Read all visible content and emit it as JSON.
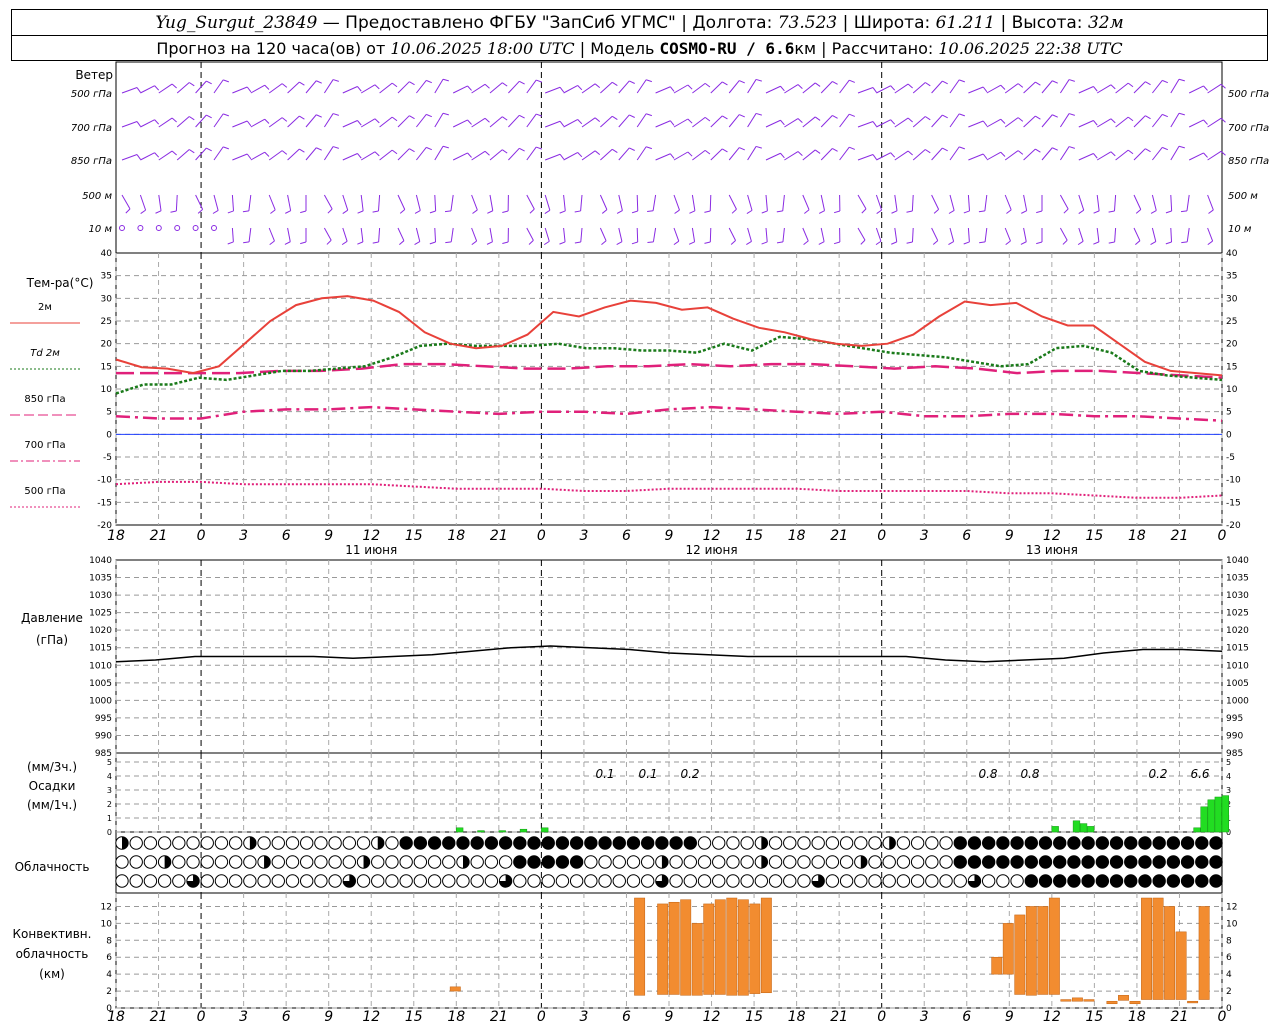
{
  "header": {
    "station": "Yug_Surgut_23849",
    "provider": " — Предоставлено ФГБУ \"ЗапСиб УГМС\" | Долгота: ",
    "lon": "73.523",
    "lat_label": " | Широта: ",
    "lat": "61.211",
    "alt_label": " | Высота: ",
    "alt": "32м",
    "forecast": "Прогноз на 120 часа(ов) от ",
    "start": "10.06.2025 18:00 UTC",
    "model_label": " | Модель ",
    "model": "COSMO-RU / 6.6",
    "model_unit": "км",
    "calc_label": " | Рассчитано: ",
    "calc": "10.06.2025 22:38 UTC"
  },
  "time_axis": {
    "hours": [
      "18",
      "21",
      "0",
      "3",
      "6",
      "9",
      "12",
      "15",
      "18",
      "21",
      "0",
      "3",
      "6",
      "9",
      "12",
      "15",
      "18",
      "21",
      "0",
      "3",
      "6",
      "9",
      "12",
      "15",
      "18",
      "21",
      "0"
    ],
    "days": [
      "11 июня",
      "12 июня",
      "13 июня"
    ]
  },
  "wind_panel": {
    "title": "Ветер",
    "levels": [
      "500 гПа",
      "700 гПа",
      "850 гПа",
      "500 м",
      "10  м"
    ],
    "barb_color": "#8a2be2"
  },
  "temp_panel": {
    "title": "Тем-ра(°C)",
    "legend": [
      {
        "label": "2м",
        "color": "#e8413a",
        "style": "solid"
      },
      {
        "label": "Td  2м",
        "color": "#1a7a1a",
        "style": "dotted"
      },
      {
        "label": "850 гПа",
        "color": "#e0207a",
        "style": "longdash"
      },
      {
        "label": "700 гПа",
        "color": "#e0207a",
        "style": "dashdot"
      },
      {
        "label": "500 гПа",
        "color": "#e0207a",
        "style": "dotted"
      }
    ],
    "yticks": [
      "40",
      "35",
      "30",
      "25",
      "20",
      "15",
      "10",
      "5",
      "0",
      "-5",
      "-10",
      "-15",
      "-20"
    ]
  },
  "pressure_panel": {
    "title": "Давление",
    "unit": "(гПа)",
    "yticks": [
      "1040",
      "1035",
      "1030",
      "1025",
      "1020",
      "1015",
      "1010",
      "1005",
      "1000",
      "995",
      "990",
      "985"
    ]
  },
  "precip_panel": {
    "unit3": "(мм/3ч.)",
    "title": "Осадки",
    "unit1": "(мм/1ч.)",
    "yticks": [
      "5",
      "4",
      "3",
      "2",
      "1",
      "0"
    ],
    "labels": [
      "0.1",
      "0.1",
      "0.2",
      "0.8",
      "0.8",
      "0.2",
      "6.6"
    ]
  },
  "cloud_panel": {
    "title": "Облачность"
  },
  "conv_panel": {
    "title1": "Конвективн.",
    "title2": "облачность",
    "unit": "(км)",
    "yticks": [
      "12",
      "10",
      "8",
      "6",
      "4",
      "2",
      "0"
    ]
  },
  "chart_data": {
    "type": "line",
    "x_hours_from_start": [
      0,
      3,
      6,
      9,
      12,
      15,
      18,
      21,
      24,
      27,
      30,
      33,
      36,
      39,
      42,
      45,
      48,
      51,
      54,
      57,
      60,
      63,
      66,
      69,
      72,
      75,
      78
    ],
    "t2m": [
      16.5,
      14.8,
      14.5,
      13.5,
      15,
      20,
      25,
      28.5,
      30,
      30.5,
      29.5,
      27,
      22.5,
      20,
      19,
      19.5,
      22,
      27,
      26,
      28,
      29.5,
      29,
      27.5,
      28,
      25.5,
      23.5,
      22.5,
      21,
      20,
      19.5,
      20,
      22,
      26,
      29.3,
      28.5,
      29,
      26,
      24,
      24,
      20,
      16,
      14,
      13.5,
      13
    ],
    "td2m": [
      9,
      11,
      11,
      12.5,
      12,
      13,
      14,
      14,
      14.5,
      15,
      17,
      19.5,
      20,
      19.5,
      19.5,
      19.5,
      20,
      19,
      19,
      18.5,
      18.5,
      18,
      20,
      18.5,
      21.5,
      21,
      20,
      19,
      18,
      17.5,
      17,
      16,
      15,
      15.5,
      19,
      19.5,
      18,
      14,
      13,
      12.5,
      12
    ],
    "t850": [
      13.5,
      13.5,
      13.5,
      13.5,
      14,
      14,
      14.5,
      15.5,
      15.5,
      15,
      14.5,
      14.5,
      15,
      15,
      15.5,
      15,
      15.5,
      15.5,
      15,
      14.5,
      15,
      14.5,
      13.5,
      14,
      14,
      13.5,
      13,
      12.5
    ],
    "t700": [
      4,
      3.5,
      3.5,
      5,
      5.5,
      5.5,
      6,
      5.5,
      5,
      4.5,
      5,
      5,
      4.5,
      5.5,
      6,
      5.5,
      5,
      4.5,
      5,
      4,
      4,
      4.5,
      4.5,
      4,
      4,
      3.5,
      3
    ],
    "t500": [
      -11,
      -10.5,
      -10.5,
      -11,
      -11,
      -11,
      -11,
      -11.5,
      -12,
      -12,
      -12,
      -12.5,
      -12.5,
      -12,
      -12,
      -12,
      -12,
      -12.5,
      -12.5,
      -12.5,
      -12.5,
      -13,
      -13,
      -13.5,
      -14,
      -14,
      -13.5
    ],
    "pressure": [
      1011,
      1011.5,
      1012.5,
      1012.5,
      1012.5,
      1012.5,
      1012,
      1012.5,
      1013,
      1014,
      1015,
      1015.5,
      1015,
      1014.5,
      1013.5,
      1013,
      1012.5,
      1012.5,
      1012.5,
      1012.5,
      1012.5,
      1011.5,
      1011,
      1011.5,
      1012,
      1013.5,
      1014.5,
      1014.5,
      1014
    ],
    "precip_1h": [
      {
        "h": 48,
        "v": 0.3
      },
      {
        "h": 51,
        "v": 0.1
      },
      {
        "h": 54,
        "v": 0.1
      },
      {
        "h": 57,
        "v": 0.2
      },
      {
        "h": 60,
        "v": 0.3
      },
      {
        "h": 132,
        "v": 0.4
      },
      {
        "h": 135,
        "v": 0.8
      },
      {
        "h": 136,
        "v": 0.6
      },
      {
        "h": 137,
        "v": 0.4
      },
      {
        "h": 152,
        "v": 0.3
      },
      {
        "h": 153,
        "v": 1.8
      },
      {
        "h": 154,
        "v": 2.3
      },
      {
        "h": 155,
        "v": 2.5
      },
      {
        "h": 156,
        "v": 2.6
      }
    ],
    "convective_cloud_km": [
      {
        "h": 29,
        "b": 2,
        "t": 2.5
      },
      {
        "h": 45,
        "b": 1.5,
        "t": 13
      },
      {
        "h": 47,
        "b": 1.6,
        "t": 12.3
      },
      {
        "h": 48,
        "b": 1.6,
        "t": 12.5
      },
      {
        "h": 49,
        "b": 1.5,
        "t": 12.8
      },
      {
        "h": 50,
        "b": 1.5,
        "t": 10
      },
      {
        "h": 51,
        "b": 1.6,
        "t": 12.3
      },
      {
        "h": 52,
        "b": 1.6,
        "t": 12.8
      },
      {
        "h": 53,
        "b": 1.5,
        "t": 13
      },
      {
        "h": 54,
        "b": 1.5,
        "t": 12.8
      },
      {
        "h": 55,
        "b": 1.7,
        "t": 12.3
      },
      {
        "h": 56,
        "b": 1.8,
        "t": 13
      },
      {
        "h": 76,
        "b": 4,
        "t": 6
      },
      {
        "h": 77,
        "b": 4,
        "t": 10
      },
      {
        "h": 78,
        "b": 1.6,
        "t": 11
      },
      {
        "h": 79,
        "b": 1.5,
        "t": 12
      },
      {
        "h": 80,
        "b": 1.6,
        "t": 12
      },
      {
        "h": 81,
        "b": 1.6,
        "t": 13
      },
      {
        "h": 82,
        "b": 0.8,
        "t": 1
      },
      {
        "h": 83,
        "b": 0.8,
        "t": 1.2
      },
      {
        "h": 84,
        "b": 0.8,
        "t": 1
      },
      {
        "h": 86,
        "b": 0.5,
        "t": 0.8
      },
      {
        "h": 87,
        "b": 0.9,
        "t": 1.5
      },
      {
        "h": 88,
        "b": 0.5,
        "t": 0.8
      },
      {
        "h": 89,
        "b": 1,
        "t": 13
      },
      {
        "h": 90,
        "b": 1,
        "t": 13
      },
      {
        "h": 91,
        "b": 1,
        "t": 12
      },
      {
        "h": 92,
        "b": 1,
        "t": 9
      },
      {
        "h": 93,
        "b": 0.6,
        "t": 0.8
      },
      {
        "h": 94,
        "b": 1,
        "t": 12
      }
    ]
  }
}
